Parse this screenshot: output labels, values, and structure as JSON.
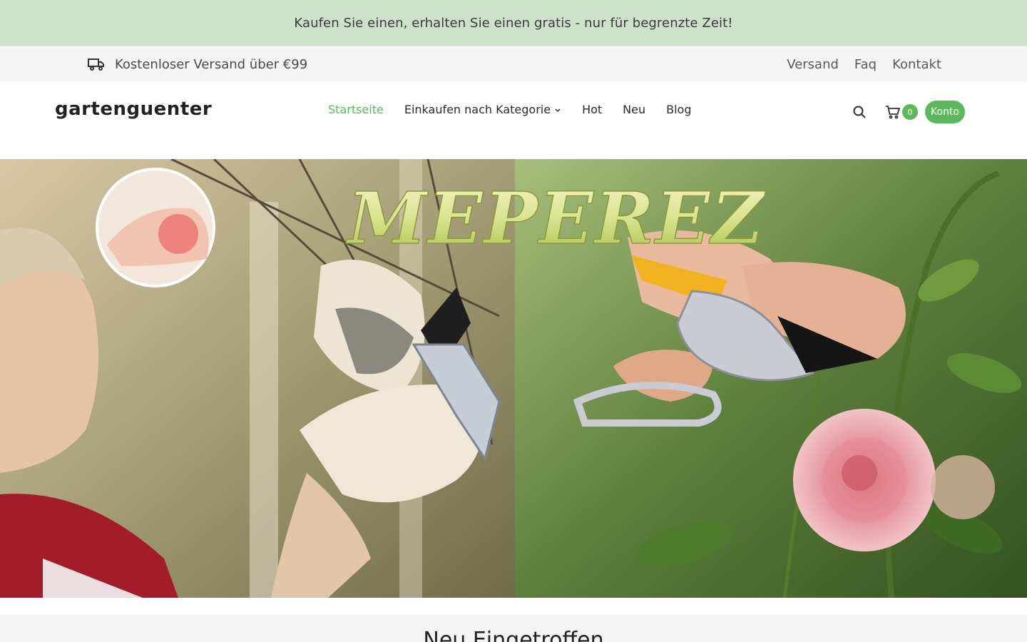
{
  "promo": {
    "text": "Kaufen Sie einen, erhalten Sie einen gratis - nur für begrenzte Zeit!"
  },
  "utility": {
    "shipping_icon": "truck-icon",
    "shipping_text": "Kostenloser Versand über €99",
    "links": [
      "Versand",
      "Faq",
      "Kontakt"
    ]
  },
  "header": {
    "logo": "gartenguenter",
    "nav": [
      {
        "label": "Startseite",
        "active": true
      },
      {
        "label": "Einkaufen nach Kategorie",
        "dropdown": true
      },
      {
        "label": "Hot"
      },
      {
        "label": "Neu"
      },
      {
        "label": "Blog"
      }
    ],
    "cart_count": "0",
    "account_label": "Konto"
  },
  "hero": {
    "brand_text": "MEPEREZ"
  },
  "section": {
    "title": "Neu Eingetroffen"
  },
  "colors": {
    "accent": "#5cb85c",
    "promo_bg": "#cde3c9",
    "utility_bg": "#f4f4f4"
  }
}
